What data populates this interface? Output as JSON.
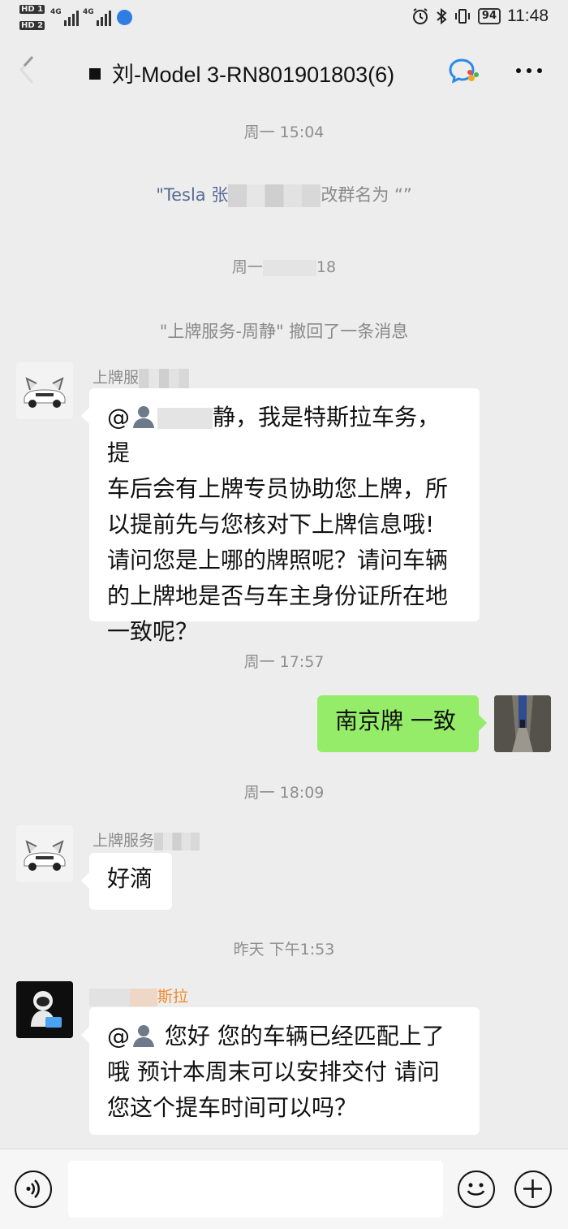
{
  "status_bar": {
    "hd1": "HD 1",
    "hd2": "HD 2",
    "sim1": "4G",
    "sim2": "4G",
    "battery": "94",
    "time": "11:48"
  },
  "header": {
    "title": "刘-Model 3-RN801901803(6)"
  },
  "messages": {
    "ts1": "周一 15:04",
    "sys1_a": "\"Tesla 张",
    "sys1_b": "改群名为 “”",
    "ts2_a": "周一",
    "ts2_b": "18",
    "sys2": "\"上牌服务-周静\" 撤回了一条消息",
    "sender1": "上牌服",
    "bubble1_at": "@",
    "bubble1_l1": "静，我是特斯拉车务，提",
    "bubble1_l2": "车后会有上牌专员协助您上牌，所",
    "bubble1_l3": "以提前先与您核对下上牌信息哦!",
    "bubble1_l4": "请问您是上哪的牌照呢？请问车辆",
    "bubble1_l5": "的上牌地是否与车主身份证所在地",
    "bubble1_l6": "一致呢？",
    "ts3": "周一 17:57",
    "my_reply": "南京牌 一致",
    "ts4": "周一 18:09",
    "sender2": "上牌服务",
    "bubble2": "好滴",
    "ts5": "昨天 下午1:53",
    "sender3": "斯拉",
    "bubble3_at": "@",
    "bubble3_l1": " 您好  您的车辆已经匹配上了",
    "bubble3_l2": "哦  预计本周末可以安排交付  请问",
    "bubble3_l3": "您这个提车时间可以吗？"
  },
  "colors": {
    "background": "#ededed",
    "my_bubble": "#95ec69",
    "other_bubble": "#ffffff",
    "timestamp": "#8e8e8e",
    "nickname": "#576b95"
  },
  "icons": [
    "back-arrow-icon",
    "wecom-icon",
    "more-icon",
    "voice-icon",
    "emoji-icon",
    "plus-icon",
    "alarm-icon",
    "bluetooth-icon",
    "vibrate-icon",
    "user-silhouette-icon"
  ]
}
